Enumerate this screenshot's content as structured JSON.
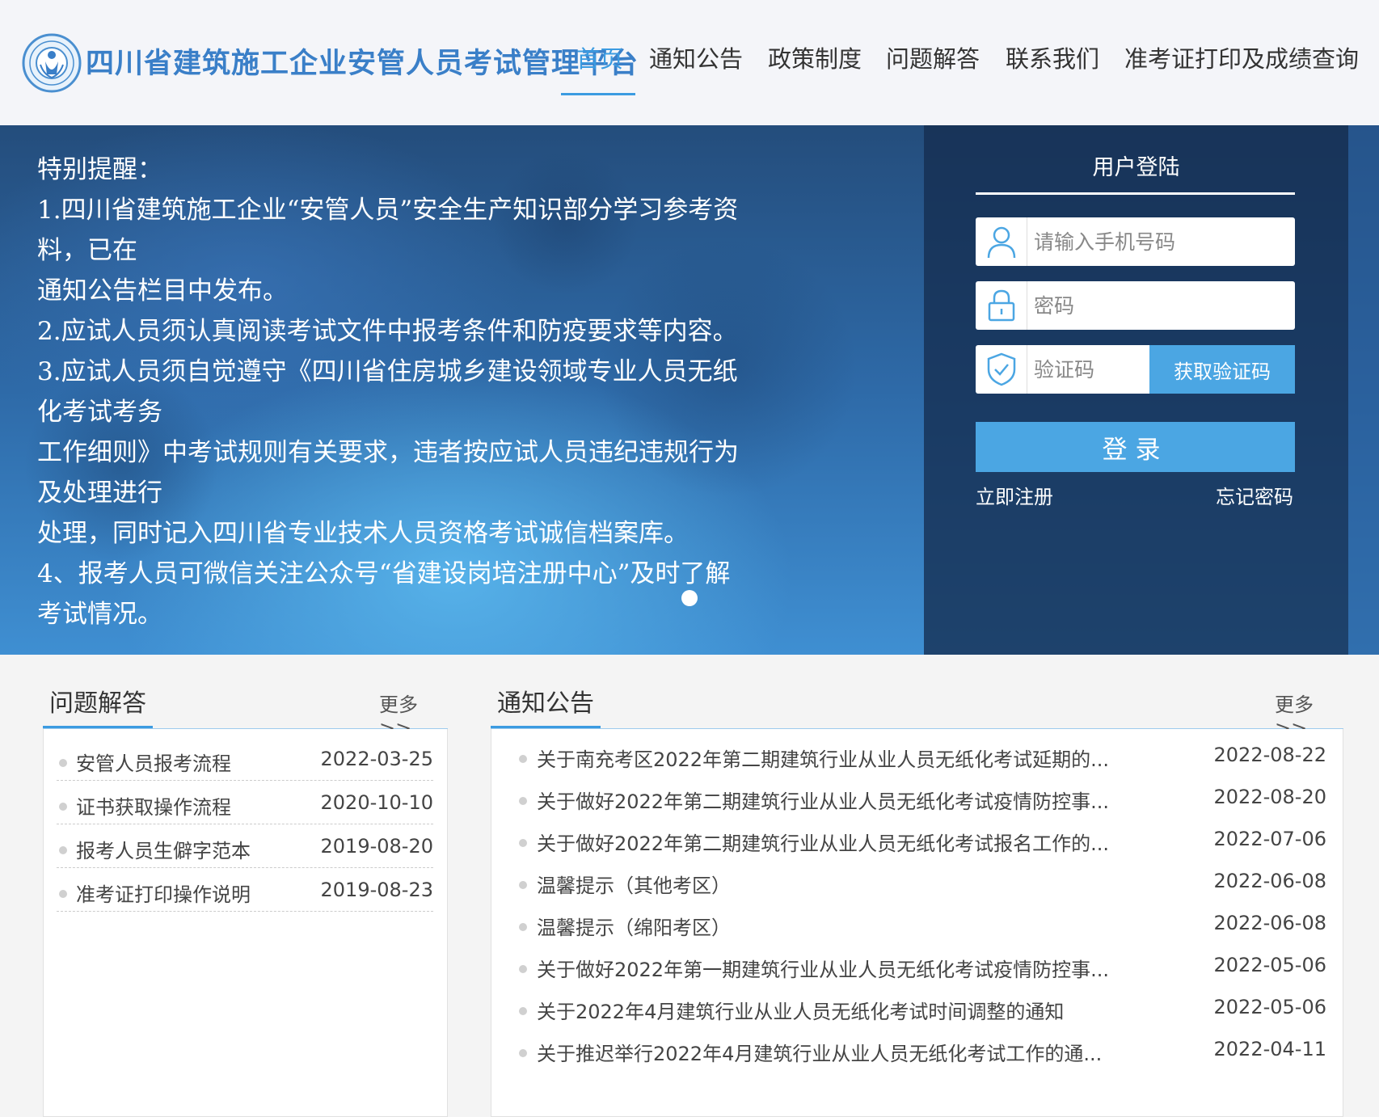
{
  "header": {
    "site_title": "四川省建筑施工企业安管人员考试管理平台",
    "nav": [
      "首页",
      "通知公告",
      "政策制度",
      "问题解答",
      "联系我们",
      "准考证打印及成绩查询"
    ],
    "active_index": 0
  },
  "banner": {
    "notice_lines": [
      "特别提醒：",
      "1.四川省建筑施工企业“安管人员”安全生产知识部分学习参考资料，已在",
      "通知公告栏目中发布。",
      "2.应试人员须认真阅读考试文件中报考条件和防疫要求等内容。",
      "3.应试人员须自觉遵守《四川省住房城乡建设领域专业人员无纸化考试考务",
      "工作细则》中考试规则有关要求，违者按应试人员违纪违规行为及处理进行",
      "处理，同时记入四川省专业技术人员资格考试诚信档案库。",
      "4、报考人员可微信关注公众号“省建设岗培注册中心”及时了解考试情况。"
    ]
  },
  "login": {
    "title": "用户登陆",
    "phone_placeholder": "请输入手机号码",
    "password_placeholder": "密码",
    "code_placeholder": "验证码",
    "get_code_label": "获取验证码",
    "login_label": "登录",
    "register_label": "立即注册",
    "forgot_label": "忘记密码"
  },
  "qa": {
    "title": "问题解答",
    "more": "更多>>",
    "items": [
      {
        "text": "安管人员报考流程",
        "date": "2022-03-25"
      },
      {
        "text": "证书获取操作流程",
        "date": "2020-10-10"
      },
      {
        "text": "报考人员生僻字范本",
        "date": "2019-08-20"
      },
      {
        "text": "准考证打印操作说明",
        "date": "2019-08-23"
      }
    ]
  },
  "news": {
    "title": "通知公告",
    "more": "更多>>",
    "items": [
      {
        "text": "关于南充考区2022年第二期建筑行业从业人员无纸化考试延期的...",
        "date": "2022-08-22"
      },
      {
        "text": "关于做好2022年第二期建筑行业从业人员无纸化考试疫情防控事...",
        "date": "2022-08-20"
      },
      {
        "text": "关于做好2022年第二期建筑行业从业人员无纸化考试报名工作的...",
        "date": "2022-07-06"
      },
      {
        "text": "温馨提示（其他考区）",
        "date": "2022-06-08"
      },
      {
        "text": "温馨提示（绵阳考区）",
        "date": "2022-06-08"
      },
      {
        "text": "关于做好2022年第一期建筑行业从业人员无纸化考试疫情防控事...",
        "date": "2022-05-06"
      },
      {
        "text": "关于2022年4月建筑行业从业人员无纸化考试时间调整的通知",
        "date": "2022-05-06"
      },
      {
        "text": "关于推迟举行2022年4月建筑行业从业人员无纸化考试工作的通...",
        "date": "2022-04-11"
      }
    ]
  },
  "colors": {
    "accent": "#3b9be1",
    "title_blue": "#3a7fc8",
    "button_blue": "#4ba6e3"
  }
}
